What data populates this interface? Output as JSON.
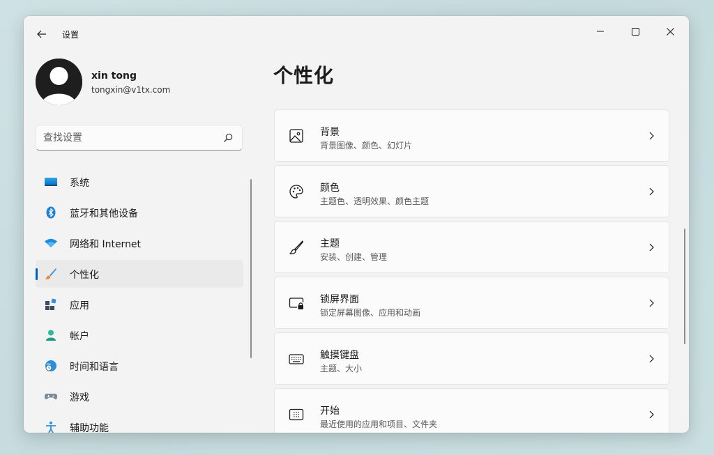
{
  "window": {
    "title": "设置"
  },
  "profile": {
    "name": "xin tong",
    "email": "tongxin@v1tx.com"
  },
  "search": {
    "placeholder": "查找设置"
  },
  "nav": {
    "items": [
      {
        "label": "系统",
        "icon": "monitor-icon"
      },
      {
        "label": "蓝牙和其他设备",
        "icon": "bluetooth-icon"
      },
      {
        "label": "网络和 Internet",
        "icon": "wifi-icon"
      },
      {
        "label": "个性化",
        "icon": "paintbrush-icon",
        "active": true
      },
      {
        "label": "应用",
        "icon": "apps-icon"
      },
      {
        "label": "帐户",
        "icon": "account-icon"
      },
      {
        "label": "时间和语言",
        "icon": "globe-clock-icon"
      },
      {
        "label": "游戏",
        "icon": "gamepad-icon"
      },
      {
        "label": "辅助功能",
        "icon": "accessibility-icon"
      }
    ]
  },
  "main": {
    "title": "个性化",
    "cards": [
      {
        "title": "背景",
        "desc": "背景图像、颜色、幻灯片",
        "icon": "image-icon"
      },
      {
        "title": "颜色",
        "desc": "主题色、透明效果、颜色主题",
        "icon": "palette-icon"
      },
      {
        "title": "主题",
        "desc": "安装、创建、管理",
        "icon": "brush-icon"
      },
      {
        "title": "锁屏界面",
        "desc": "锁定屏幕图像、应用和动画",
        "icon": "lock-screen-icon"
      },
      {
        "title": "触摸键盘",
        "desc": "主题、大小",
        "icon": "keyboard-icon"
      },
      {
        "title": "开始",
        "desc": "最近使用的应用和项目、文件夹",
        "icon": "start-icon"
      }
    ]
  },
  "colors": {
    "accent": "#005fb8",
    "window_bg": "#f3f3f3",
    "card_bg": "#fbfbfb"
  }
}
